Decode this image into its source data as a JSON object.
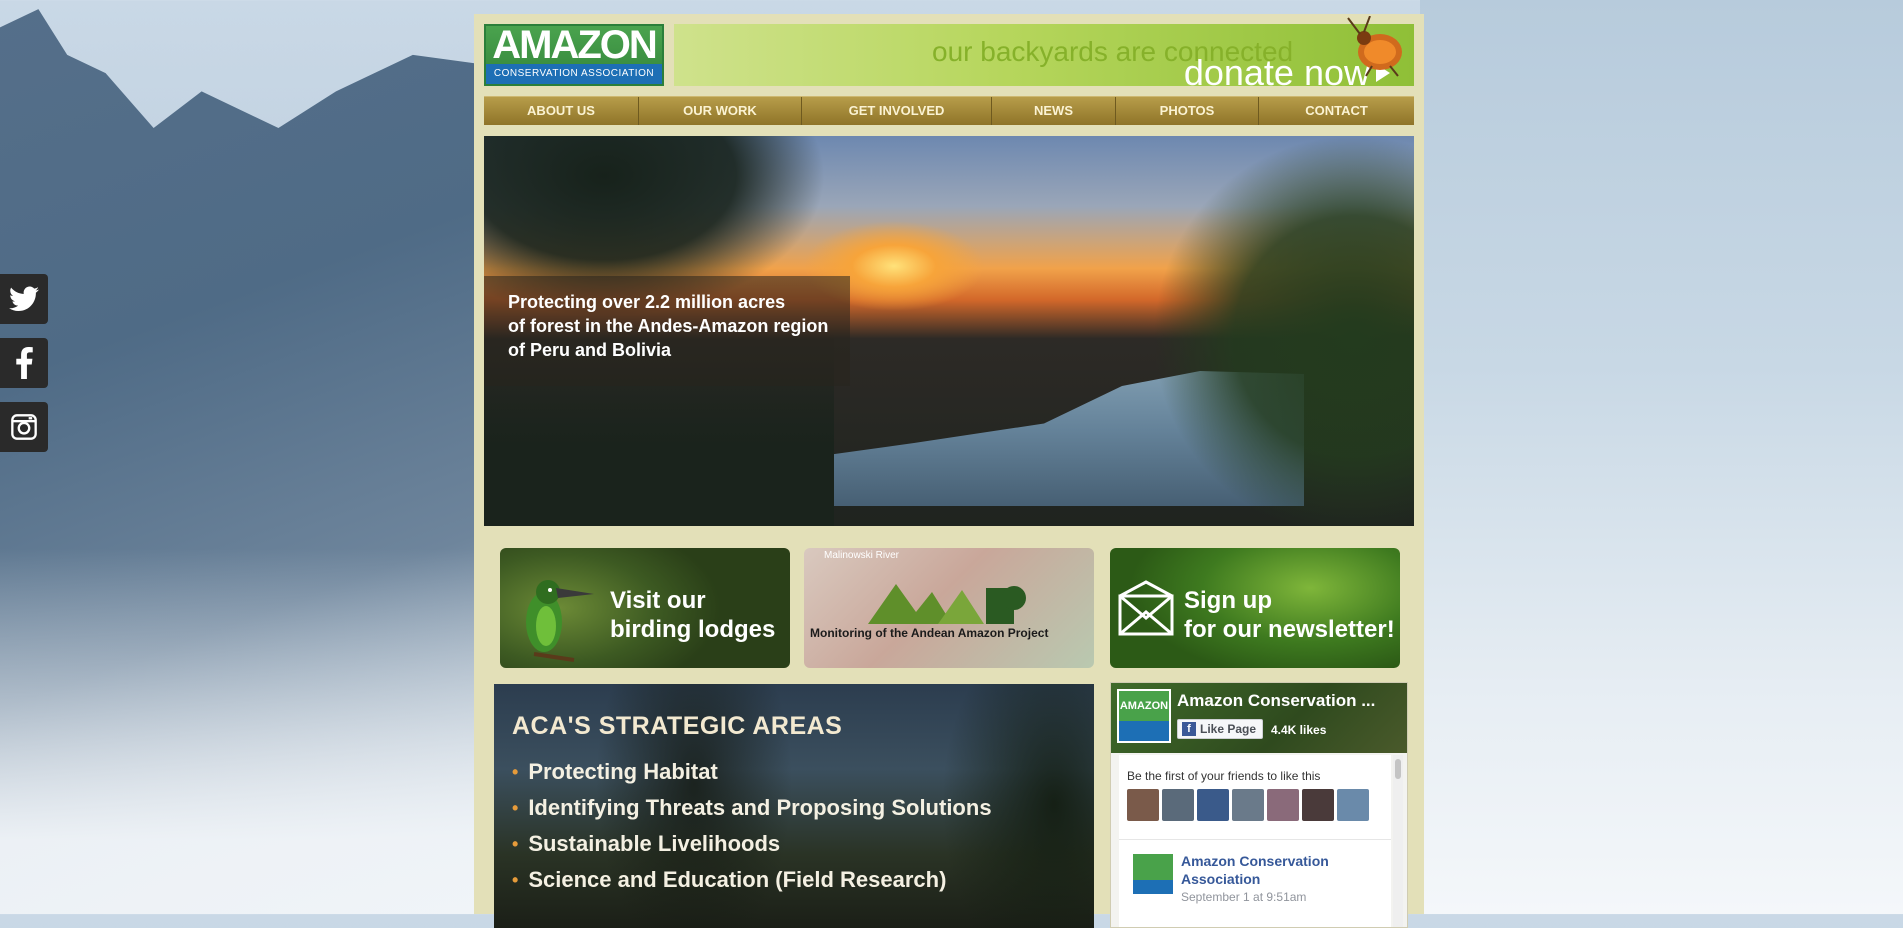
{
  "social": [
    "twitter-icon",
    "facebook-icon",
    "instagram-icon"
  ],
  "logo": {
    "top": "AMAZON",
    "bottom": "CONSERVATION ASSOCIATION"
  },
  "banner": {
    "tagline": "our backyards are connected",
    "donate": "donate now"
  },
  "nav": [
    "ABOUT US",
    "OUR WORK",
    "GET INVOLVED",
    "NEWS",
    "PHOTOS",
    "CONTACT"
  ],
  "hero": {
    "caption": "Protecting over 2.2 million acres\n of forest in the Andes-Amazon region\nof Peru and Bolivia"
  },
  "tiles": {
    "birding": "Visit our\nbirding lodges",
    "maap_river": "Malinowski River",
    "maap_title": "Monitoring of the Andean Amazon Project",
    "newsletter": "Sign up\nfor our newsletter!"
  },
  "strategic": {
    "title": "ACA'S STRATEGIC AREAS",
    "items": [
      "Protecting Habitat",
      "Identifying Threats and Proposing Solutions",
      "Sustainable Livelihoods",
      "Science and Education (Field Research)"
    ]
  },
  "facebook": {
    "page_name": "Amazon Conservation ...",
    "like_label": "Like Page",
    "likes": "4.4K likes",
    "friends_text": "Be the first of your friends to like this",
    "post_author": "Amazon Conservation Association",
    "post_time": "September 1 at 9:51am"
  },
  "colors": {
    "nav": "#9b8234",
    "container": "#e3e0b8",
    "banner": "#a9cf4f",
    "accent_dot": "#e69b3a"
  }
}
